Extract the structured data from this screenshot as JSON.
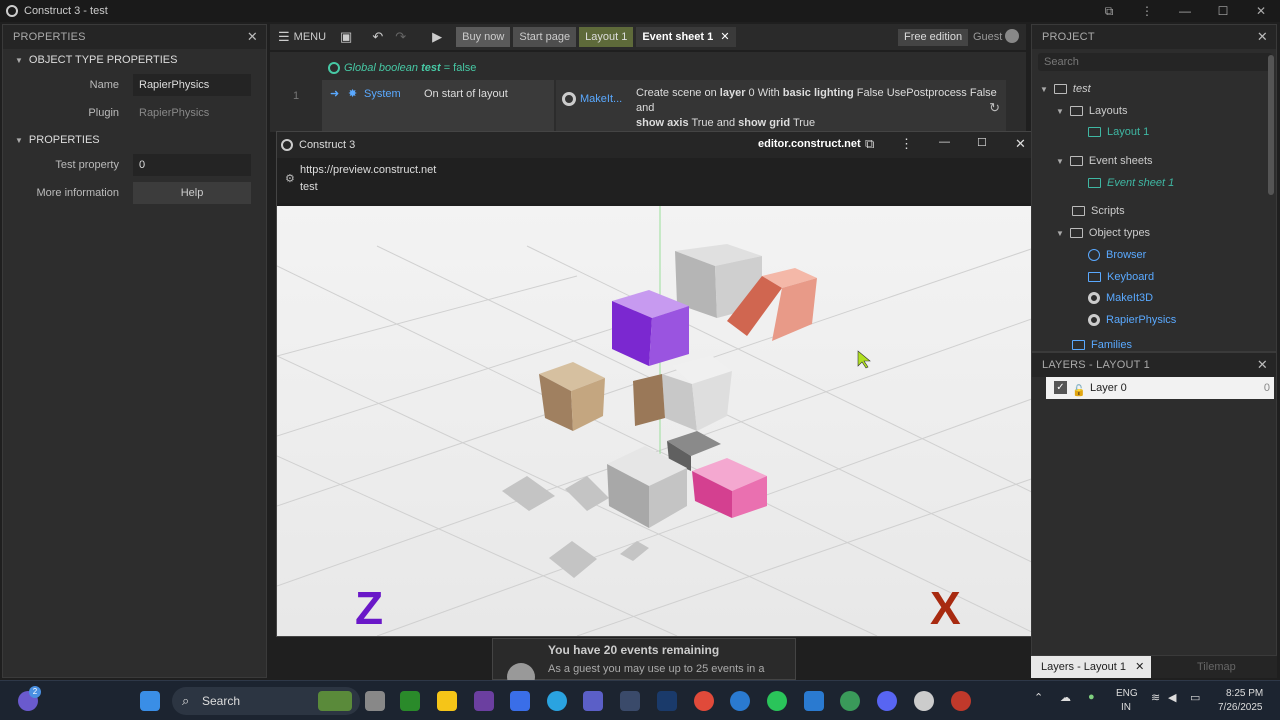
{
  "window": {
    "title": "Construct 3 - test"
  },
  "properties": {
    "header": "PROPERTIES",
    "section1": "OBJECT TYPE PROPERTIES",
    "name_label": "Name",
    "name_value": "RapierPhysics",
    "plugin_label": "Plugin",
    "plugin_value": "RapierPhysics",
    "section2": "PROPERTIES",
    "test_label": "Test property",
    "test_value": "0",
    "more_label": "More information",
    "help_label": "Help"
  },
  "toolbar": {
    "menu": "MENU",
    "buy": "Buy now",
    "start": "Start page",
    "layout": "Layout 1",
    "event_sheet": "Event sheet 1",
    "edition": "Free edition",
    "user": "Guest"
  },
  "events": {
    "global": "Global boolean",
    "global_name": "test",
    "global_value": "= false",
    "row_num": "1",
    "object": "System",
    "condition": "On start of layout",
    "action_object": "MakeIt...",
    "action_text_1": "Create scene on",
    "action_bold_1": "layer",
    "action_text_2": "0 With",
    "action_bold_2": "basic lighting",
    "action_text_3": "False UsePostprocess False and",
    "action_bold_3": "show axis",
    "action_text_4": "True and",
    "action_bold_4": "show grid",
    "action_text_5": "True"
  },
  "preview": {
    "title": "Construct 3",
    "domain": "editor.construct.net",
    "url": "https://preview.construct.net",
    "page": "test",
    "axis_z": "Z",
    "axis_x": "X"
  },
  "project": {
    "header": "PROJECT",
    "search_placeholder": "Search",
    "root": "test",
    "layouts": "Layouts",
    "layout1": "Layout 1",
    "event_sheets": "Event sheets",
    "event_sheet1": "Event sheet 1",
    "scripts": "Scripts",
    "object_types": "Object types",
    "obj1": "Browser",
    "obj2": "Keyboard",
    "obj3": "MakeIt3D",
    "obj4": "RapierPhysics",
    "families": "Families"
  },
  "layers": {
    "header": "LAYERS - LAYOUT 1",
    "layer_name": "Layer 0",
    "layer_index": "0",
    "tab": "Layers - Layout 1",
    "tab2": "Tilemap"
  },
  "notice": {
    "title": "You have 20 events remaining",
    "body": "As a guest you may use up to 25 events in a"
  },
  "taskbar": {
    "search": "Search",
    "lang1": "ENG",
    "lang2": "IN",
    "time": "8:25 PM",
    "date": "7/26/2025",
    "badge": "2"
  },
  "colors": {
    "accent": "#3fb7a3",
    "link": "#5aa9ff",
    "tab_layout": "#8a9a55"
  }
}
